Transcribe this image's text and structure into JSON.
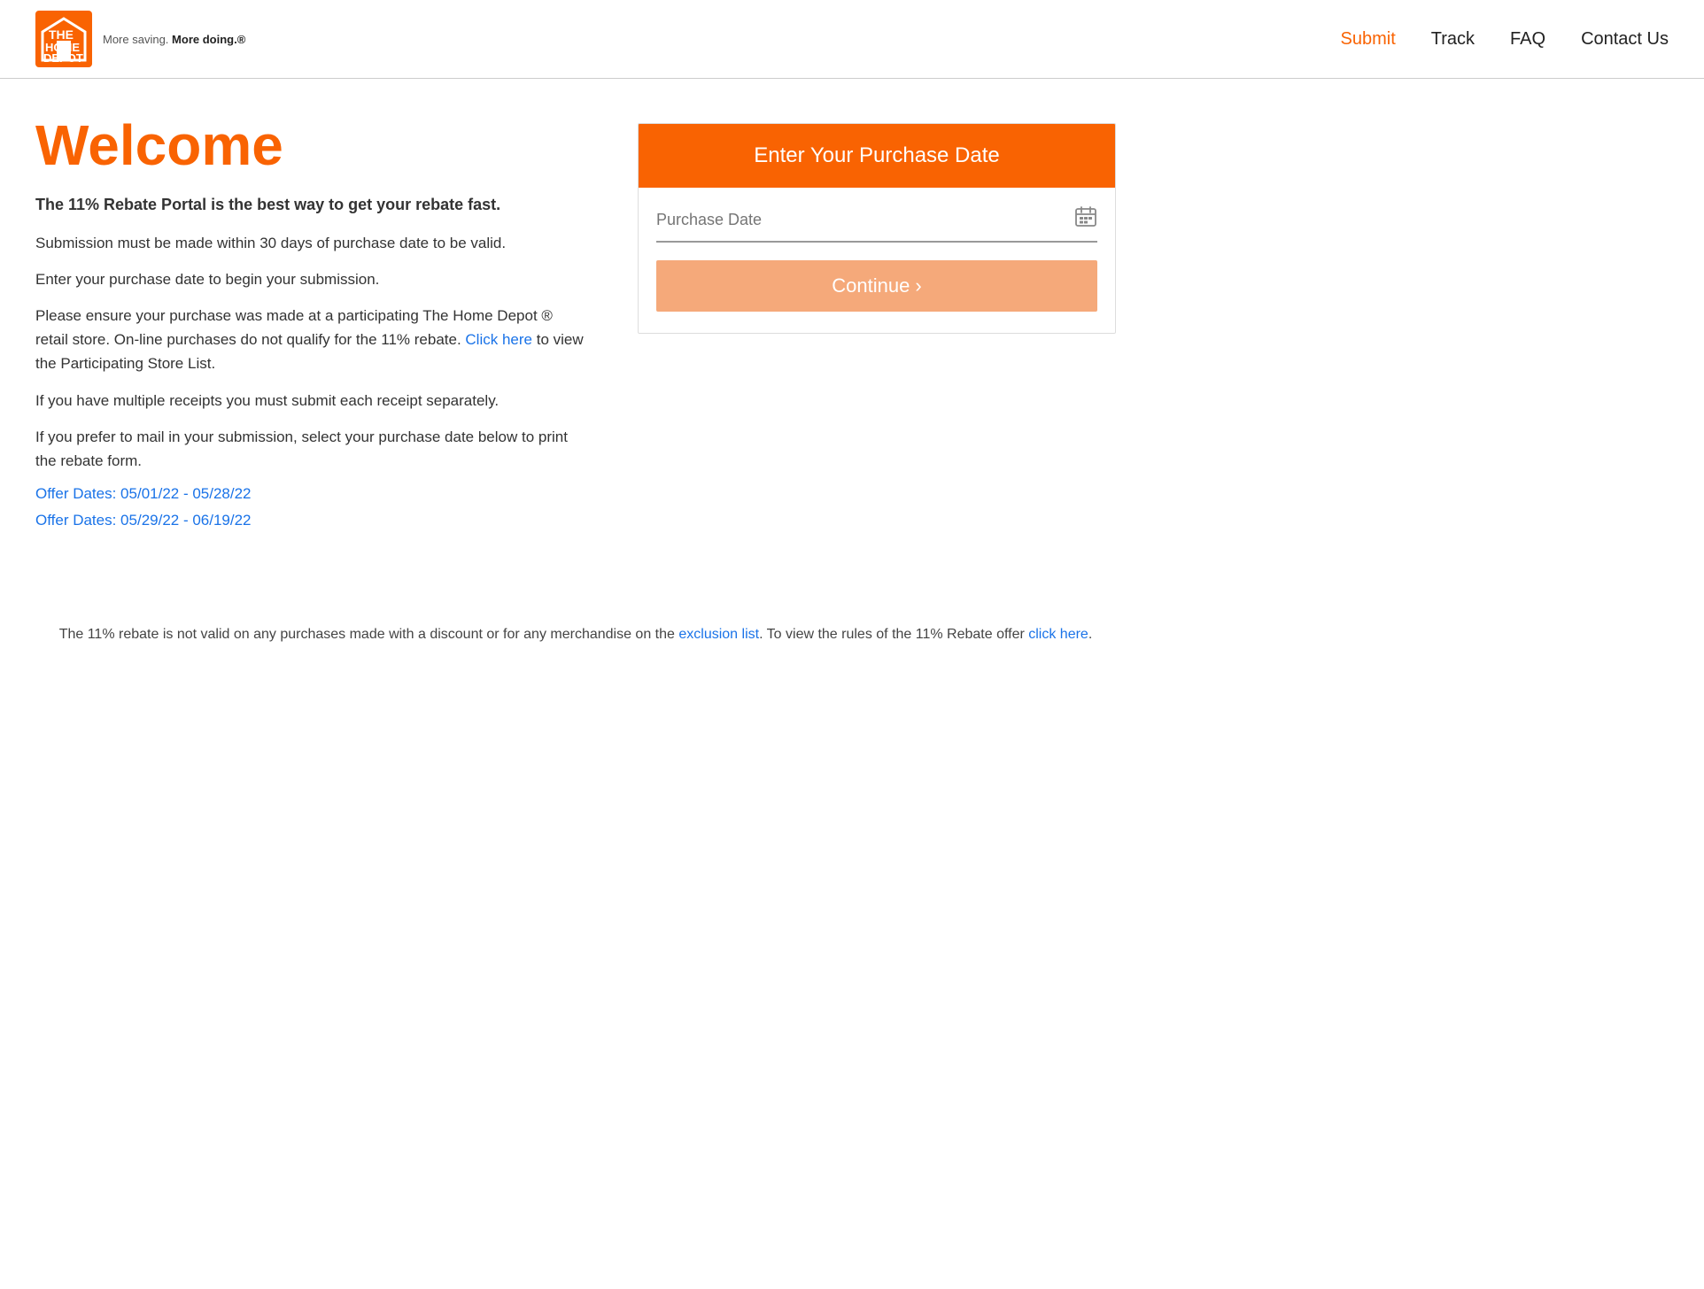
{
  "header": {
    "tagline": "More saving. ",
    "tagline_bold": "More doing.®",
    "nav": {
      "submit": "Submit",
      "track": "Track",
      "faq": "FAQ",
      "contact": "Contact Us"
    }
  },
  "main": {
    "welcome_title": "Welcome",
    "intro_bold": "The 11% Rebate Portal is the best way to get your rebate fast.",
    "paragraph1": "Submission must be made within 30 days of purchase date to be valid.",
    "paragraph2": "Enter your purchase date to begin your submission.",
    "paragraph3_pre": "Please ensure your purchase was made at a participating The Home Depot ® retail store. On-line purchases do not qualify for the 11% rebate. ",
    "paragraph3_link": "Click here",
    "paragraph3_post": " to view the Participating Store List.",
    "paragraph4": "If you have multiple receipts you must submit each receipt separately.",
    "paragraph5": "If you prefer to mail in your submission, select your purchase date below to print the rebate form.",
    "offer1": "Offer Dates: 05/01/22 - 05/28/22",
    "offer2": "Offer Dates: 05/29/22 - 06/19/22"
  },
  "panel": {
    "header": "Enter Your Purchase Date",
    "date_placeholder": "Purchase Date",
    "continue_btn": "Continue ›"
  },
  "footer_note": {
    "text1": "The 11% rebate is not valid on any purchases made with a discount or for any merchandise on the ",
    "link1": "exclusion list",
    "text2": ". To view the rules of the 11% Rebate offer ",
    "link2": "click here",
    "text3": "."
  }
}
